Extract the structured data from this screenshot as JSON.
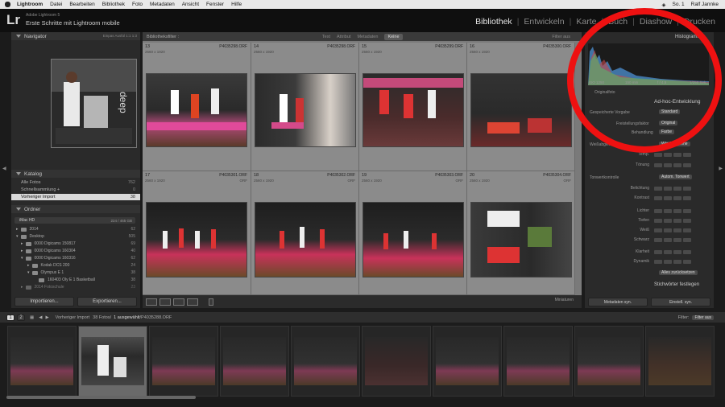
{
  "menubar": {
    "app": "Lightroom",
    "items": [
      "Datei",
      "Bearbeiten",
      "Bibliothek",
      "Foto",
      "Metadaten",
      "Ansicht",
      "Fenster",
      "Hilfe"
    ],
    "clock": "So. 1",
    "user": "Ralf Jannke"
  },
  "identity": {
    "product": "Adobe Lightroom 5",
    "title": "Erste Schritte mit Lightroom mobile",
    "logo": "Lr"
  },
  "modules": [
    "Bibliothek",
    "Entwickeln",
    "Karte",
    "Buch",
    "Diashow",
    "Drucken"
  ],
  "navigator": {
    "title": "Navigator",
    "options": "Einpas  Ausfül  1:1  1:3"
  },
  "catalog": {
    "title": "Katalog",
    "rows": [
      {
        "label": "Alle Fotos",
        "count": "762"
      },
      {
        "label": "Schnellsammlung +",
        "count": "0"
      },
      {
        "label": "Vorheriger Import",
        "count": "38"
      }
    ]
  },
  "folders": {
    "title": "Ordner",
    "volume": "iMac HD",
    "volume_size": "224 / 465 GB",
    "rows": [
      {
        "label": "2014",
        "count": "62"
      },
      {
        "label": "Desktop",
        "count": "505"
      },
      {
        "label": "0000 Digicams 150817",
        "count": "69"
      },
      {
        "label": "0000 Digicams 160304",
        "count": "40"
      },
      {
        "label": "0000 Digicams 160316",
        "count": "62"
      },
      {
        "label": "Kodak DCS 200",
        "count": "24"
      },
      {
        "label": "Olympus E 1",
        "count": "38"
      },
      {
        "label": "160403 Oly E 1 Basketball",
        "count": "38"
      },
      {
        "label": "2014 Fotoschule",
        "count": "23"
      }
    ]
  },
  "left_buttons": {
    "import": "Importieren...",
    "export": "Exportieren..."
  },
  "filterbar": {
    "title": "Bibliotheksfilter :",
    "tabs": [
      "Text",
      "Attribut",
      "Metadaten",
      "Keine"
    ],
    "filter_off": "Filter aus"
  },
  "grid": [
    {
      "num": "13",
      "name": "P4035298.ORF",
      "dim": "2560 x 1920",
      "ext": ""
    },
    {
      "num": "14",
      "name": "P4035298.ORF",
      "dim": "2560 x 1920",
      "ext": ""
    },
    {
      "num": "15",
      "name": "P4035299.ORF",
      "dim": "2560 x 1920",
      "ext": ""
    },
    {
      "num": "16",
      "name": "P4035300.ORF",
      "dim": "2560 x 1920",
      "ext": ""
    },
    {
      "num": "17",
      "name": "P4035301.ORF",
      "dim": "2560 x 1920",
      "ext": "ORF"
    },
    {
      "num": "18",
      "name": "P4035302.ORF",
      "dim": "2560 x 1920",
      "ext": "ORF"
    },
    {
      "num": "19",
      "name": "P4035303.ORF",
      "dim": "2560 x 1920",
      "ext": "ORF"
    },
    {
      "num": "20",
      "name": "P4035304.ORF",
      "dim": "2560 x 1920",
      "ext": "ORF"
    }
  ],
  "toolbar": {
    "sort_label": "Miniaturen"
  },
  "histogram": {
    "title": "Histogramm",
    "iso": "ISO 1250",
    "focal": "150 mm",
    "aperture": "f / 4,5",
    "shutter": "1/250 Sek.",
    "original": "Originalfoto"
  },
  "quick_develop": {
    "title": "Ad-hoc-Entwicklung",
    "preset_label": "Gespeicherte Vorgabe",
    "preset_value": "Standard",
    "crop_label": "Freistellungsfaktor",
    "crop_value": "Original",
    "treat_label": "Behandlung",
    "treat_value": "Farbe",
    "wb_label": "Weißabgleich",
    "wb_value": "Wie Aufnahme",
    "temp_label": "Temp.",
    "tint_label": "Tönung",
    "tone_label": "Tonwertkontrolle",
    "auto_tone": "Autom. Tonwert",
    "sliders": [
      "Belichtung",
      "Kontrast",
      "Lichter",
      "Tiefen",
      "Weiß",
      "Schwarz",
      "Klarheit",
      "Dynamik"
    ],
    "reset": "Alles zurücksetzen"
  },
  "keywords": {
    "title": "Stichwörter festlegen"
  },
  "sync": {
    "metadata": "Metadaten syn.",
    "settings": "Einstell. syn."
  },
  "filmbar": {
    "page1": "1",
    "page2": "2",
    "source": "Vorheriger Import",
    "summary": "38 Fotos/",
    "selected": "1 ausgewählt",
    "file": "/P4035288.ORF",
    "filter_label": "Filter:",
    "filter_value": "Filter aus"
  },
  "colors": {
    "annotation": "#ee1111",
    "selected_row": "#d9d9d9"
  }
}
